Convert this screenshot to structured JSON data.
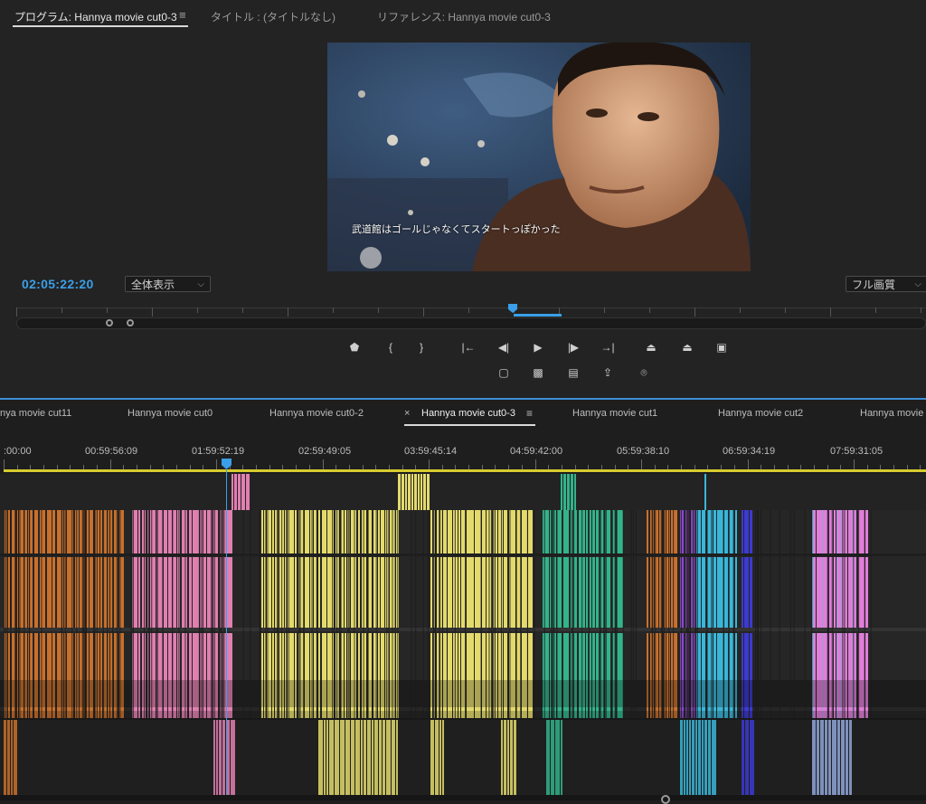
{
  "program": {
    "tabs": [
      {
        "label": "プログラム: Hannya movie cut0-3"
      },
      {
        "label": "タイトル : (タイトルなし)"
      },
      {
        "label": "リファレンス: Hannya movie cut0-3"
      }
    ],
    "menu_icon": "≡",
    "subtitle": "武道館はゴールじゃなくてスタートっぽかった",
    "timecode": "02:05:22:20",
    "zoom_select": "全体表示",
    "quality_select": "フル画質"
  },
  "controls": {
    "row1": [
      {
        "name": "add-marker-button",
        "glyph": "⬟"
      },
      {
        "name": "mark-in-button",
        "glyph": "{"
      },
      {
        "name": "mark-out-button",
        "glyph": "}"
      },
      {
        "name": "go-to-in-button",
        "glyph": "|←"
      },
      {
        "name": "step-back-button",
        "glyph": "◀|"
      },
      {
        "name": "play-button",
        "glyph": "▶"
      },
      {
        "name": "step-forward-button",
        "glyph": "|▶"
      },
      {
        "name": "go-to-out-button",
        "glyph": "→|"
      },
      {
        "name": "lift-button",
        "glyph": "⏏"
      },
      {
        "name": "extract-button",
        "glyph": "⏏"
      },
      {
        "name": "comparison-view-button",
        "glyph": "▣"
      }
    ],
    "row2": [
      {
        "name": "safe-margins-button",
        "glyph": "▢"
      },
      {
        "name": "proxy-toggle-button",
        "glyph": "▩"
      },
      {
        "name": "multi-camera-button",
        "glyph": "▤"
      },
      {
        "name": "export-frame-share-button",
        "glyph": "⇪"
      },
      {
        "name": "camera-icon",
        "glyph": "⌾"
      }
    ]
  },
  "timeline": {
    "tabs": [
      {
        "label": "nya movie cut11",
        "active": false
      },
      {
        "label": "Hannya movie cut0",
        "active": false
      },
      {
        "label": "Hannya movie cut0-2",
        "active": false
      },
      {
        "label": "Hannya movie cut0-3",
        "active": true
      },
      {
        "label": "Hannya movie cut1",
        "active": false
      },
      {
        "label": "Hannya movie cut2",
        "active": false
      },
      {
        "label": "Hannya movie",
        "active": false
      }
    ],
    "close_icon": "×",
    "menu_icon": "≡",
    "ruler": [
      ":00:00",
      "00:59:56:09",
      "01:59:52:19",
      "02:59:49:05",
      "03:59:45:14",
      "04:59:42:00",
      "05:59:38:10",
      "06:59:34:19",
      "07:59:31:05"
    ]
  },
  "colors": {
    "accent_blue": "#3a9fe8",
    "work_area": "#d8cc2e",
    "clip_orange": "#c8702c",
    "clip_pink": "#e07fb0",
    "clip_yellow": "#e3da6c",
    "clip_green": "#33b38a",
    "clip_violet": "#8a49c9",
    "clip_cyan": "#3ab6d8",
    "clip_blue": "#3c3ad0",
    "clip_lightblue": "#8fa6d8",
    "clip_magenta": "#e07ed8"
  }
}
